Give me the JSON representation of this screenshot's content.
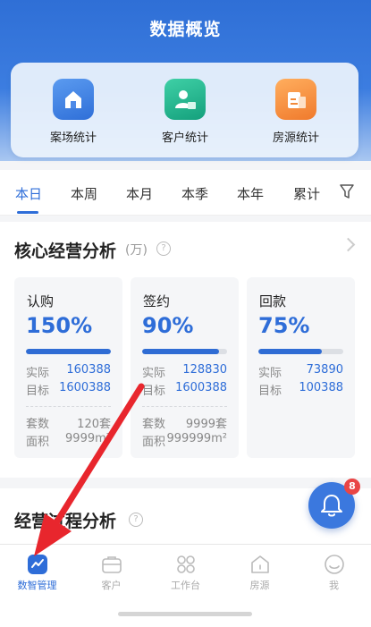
{
  "header": {
    "title": "数据概览"
  },
  "quick": [
    {
      "label": "案场统计",
      "icon": "home-icon",
      "color": "#3b7ee3"
    },
    {
      "label": "客户统计",
      "icon": "customer-icon",
      "color": "#1fae8a"
    },
    {
      "label": "房源统计",
      "icon": "house-source-icon",
      "color": "#f18a3a"
    }
  ],
  "tabs": [
    "本日",
    "本周",
    "本月",
    "本季",
    "本年",
    "累计"
  ],
  "active_tab": "本日",
  "core": {
    "title": "核心经营分析",
    "unit": "(万)",
    "help": "?",
    "cards": [
      {
        "name": "认购",
        "percent": "150%",
        "progress": 1.0,
        "actual_label": "实际",
        "actual": "160388",
        "target_label": "目标",
        "target": "1600388",
        "count_label": "套数",
        "count": "120套",
        "area_label": "面积",
        "area": "9999m²"
      },
      {
        "name": "签约",
        "percent": "90%",
        "progress": 0.9,
        "actual_label": "实际",
        "actual": "128830",
        "target_label": "目标",
        "target": "1600388",
        "count_label": "套数",
        "count": "9999套",
        "area_label": "面积",
        "area": "999999m²"
      },
      {
        "name": "回款",
        "percent": "75%",
        "progress": 0.75,
        "actual_label": "实际",
        "actual": "73890",
        "target_label": "目标",
        "target": "100388"
      }
    ]
  },
  "process": {
    "title": "经营过程分析",
    "help": "?"
  },
  "notifications": {
    "count": "8"
  },
  "nav": [
    {
      "label": "数智管理",
      "icon": "chart-icon"
    },
    {
      "label": "客户",
      "icon": "briefcase-icon"
    },
    {
      "label": "工作台",
      "icon": "grid-icon"
    },
    {
      "label": "房源",
      "icon": "house-icon"
    },
    {
      "label": "我",
      "icon": "user-icon"
    }
  ],
  "colors": {
    "primary": "#2e6dd8",
    "annotation_arrow": "#e8262d"
  }
}
